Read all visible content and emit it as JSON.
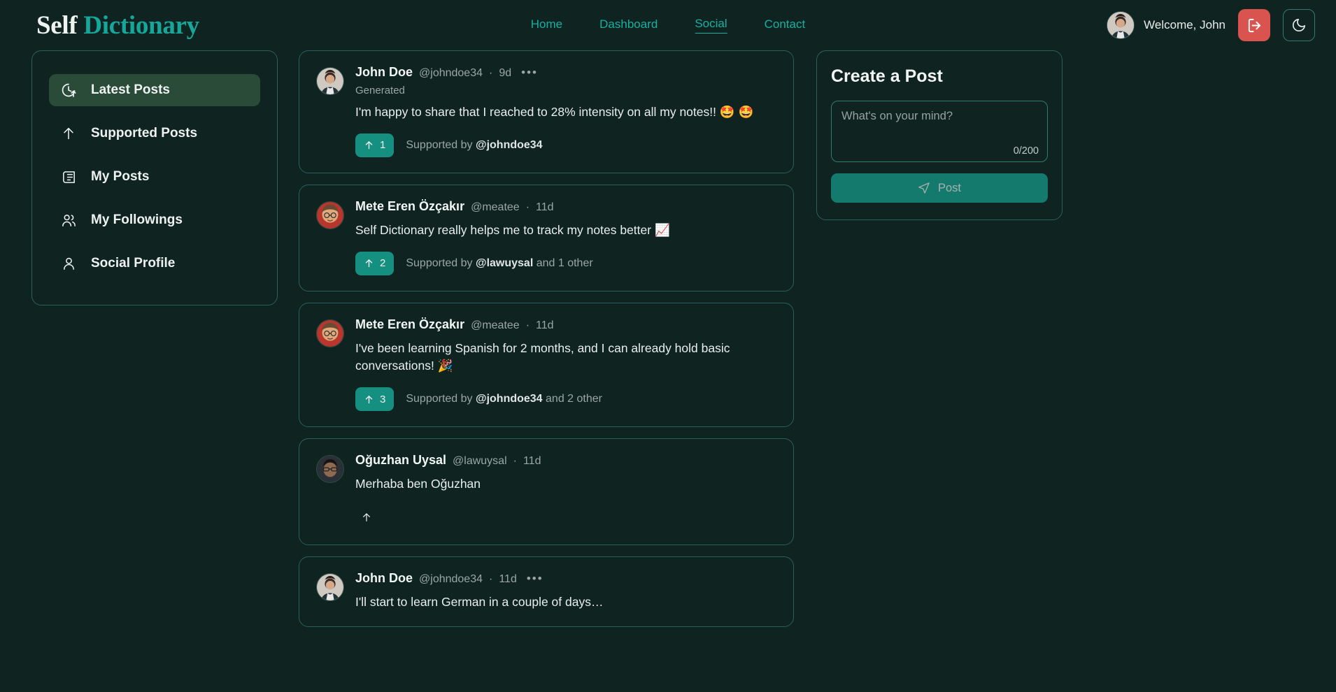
{
  "brand": {
    "word1": "Self",
    "word2": "Dictionary",
    "accent": "#16a79b"
  },
  "nav": {
    "items": [
      {
        "label": "Home",
        "active": false
      },
      {
        "label": "Dashboard",
        "active": false
      },
      {
        "label": "Social",
        "active": true
      },
      {
        "label": "Contact",
        "active": false
      }
    ]
  },
  "user": {
    "welcome": "Welcome, John",
    "avatar_icon": "user-photo-avatar",
    "logout_icon": "logout-icon",
    "theme_icon": "moon-icon",
    "logout_color": "#d9534f"
  },
  "sidebar": {
    "items": [
      {
        "label": "Latest Posts",
        "icon": "clock-arrow-icon",
        "active": true
      },
      {
        "label": "Supported Posts",
        "icon": "arrow-up-icon",
        "active": false
      },
      {
        "label": "My Posts",
        "icon": "newspaper-icon",
        "active": false
      },
      {
        "label": "My Followings",
        "icon": "users-icon",
        "active": false
      },
      {
        "label": "Social Profile",
        "icon": "user-icon",
        "active": false
      }
    ],
    "active_bg": "#2a4b38"
  },
  "feed": {
    "posts": [
      {
        "name": "John Doe",
        "handle": "@johndoe34",
        "time": "9d",
        "subtitle": "Generated",
        "has_menu": true,
        "text": "I'm happy to share that I reached to 28% intensity on all my notes!! 🤩 🤩",
        "support_count": "1",
        "support_text_prefix": "Supported by ",
        "support_text_handle": "@johndoe34",
        "support_text_suffix": "",
        "support_filled": true
      },
      {
        "name": "Mete Eren Özçakır",
        "handle": "@meatee",
        "time": "11d",
        "subtitle": "",
        "has_menu": false,
        "text": "Self Dictionary really helps me to track my notes better 📈",
        "support_count": "2",
        "support_text_prefix": "Supported by ",
        "support_text_handle": "@lawuysal",
        "support_text_suffix": " and 1 other",
        "support_filled": true
      },
      {
        "name": "Mete Eren Özçakır",
        "handle": "@meatee",
        "time": "11d",
        "subtitle": "",
        "has_menu": false,
        "text": "I've been learning Spanish for 2 months, and I can already hold basic conversations! 🎉",
        "support_count": "3",
        "support_text_prefix": "Supported by ",
        "support_text_handle": "@johndoe34",
        "support_text_suffix": " and 2 other",
        "support_filled": true
      },
      {
        "name": "Oğuzhan Uysal",
        "handle": "@lawuysal",
        "time": "11d",
        "subtitle": "",
        "has_menu": false,
        "text": "Merhaba ben Oğuzhan",
        "support_count": "",
        "support_text_prefix": "",
        "support_text_handle": "",
        "support_text_suffix": "",
        "support_filled": false
      },
      {
        "name": "John Doe",
        "handle": "@johndoe34",
        "time": "11d",
        "subtitle": "",
        "has_menu": true,
        "text": "I'll start to learn German in a couple of days…",
        "support_count": "",
        "support_text_prefix": "",
        "support_text_handle": "",
        "support_text_suffix": "",
        "support_filled": false
      }
    ],
    "separator": "·",
    "menu_glyph": "•••"
  },
  "create_post": {
    "title": "Create a Post",
    "placeholder": "What's on your mind?",
    "value": "",
    "counter": "0/200",
    "button_label": "Post",
    "button_icon": "send-icon",
    "button_color": "#147a6e"
  }
}
